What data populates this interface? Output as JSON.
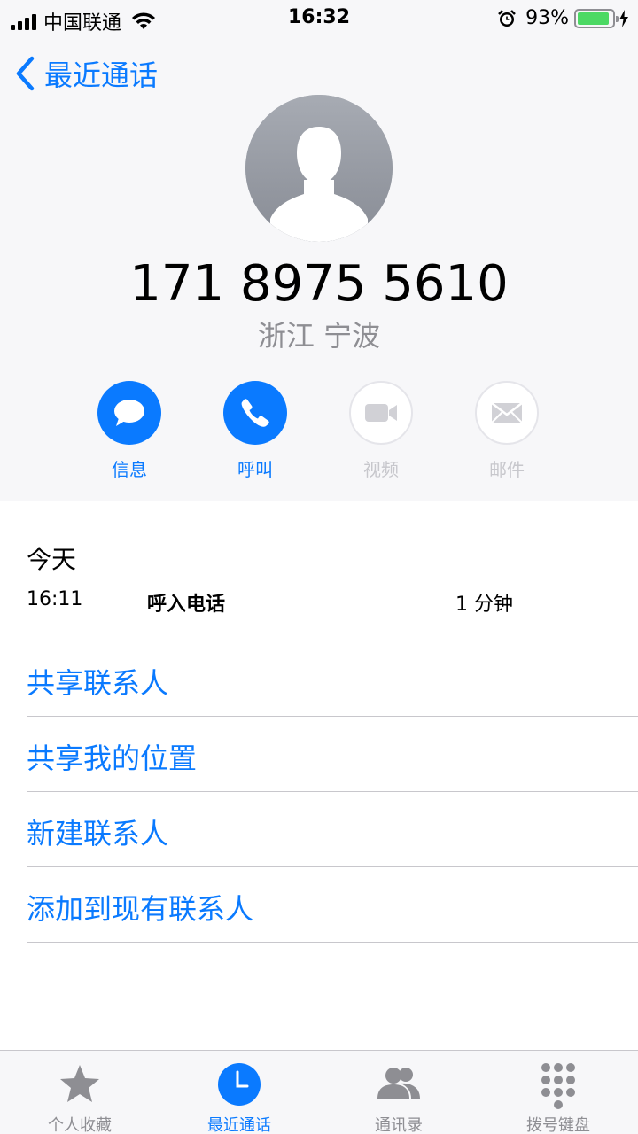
{
  "status_bar": {
    "carrier": "中国联通",
    "time": "16:32",
    "battery_percent": "93%",
    "battery_level": 0.93
  },
  "nav": {
    "back_label": "最近通话"
  },
  "contact": {
    "phone_number": "171 8975 5610",
    "location": "浙江 宁波"
  },
  "actions": [
    {
      "label": "信息",
      "icon": "message-icon",
      "enabled": true
    },
    {
      "label": "呼叫",
      "icon": "phone-icon",
      "enabled": true
    },
    {
      "label": "视频",
      "icon": "video-icon",
      "enabled": false
    },
    {
      "label": "邮件",
      "icon": "mail-icon",
      "enabled": false
    }
  ],
  "history": {
    "day": "今天",
    "entries": [
      {
        "time": "16:11",
        "type": "呼入电话",
        "duration": "1 分钟"
      }
    ]
  },
  "options": [
    {
      "label": "共享联系人"
    },
    {
      "label": "共享我的位置"
    },
    {
      "label": "新建联系人"
    },
    {
      "label": "添加到现有联系人"
    }
  ],
  "tabbar": {
    "tabs": [
      {
        "label": "个人收藏",
        "icon": "star-icon",
        "active": false
      },
      {
        "label": "最近通话",
        "icon": "clock-icon",
        "active": true
      },
      {
        "label": "通讯录",
        "icon": "contacts-icon",
        "active": false
      },
      {
        "label": "拨号键盘",
        "icon": "keypad-icon",
        "active": false
      }
    ]
  },
  "colors": {
    "accent": "#0a7aff",
    "secondary_text": "#8e8e93",
    "disabled": "#c7c7cc",
    "battery_green": "#4cd964"
  }
}
